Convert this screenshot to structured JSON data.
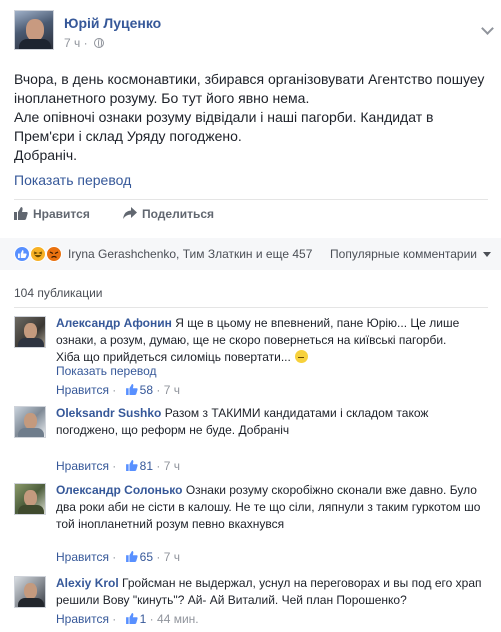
{
  "post": {
    "author": "Юрій Луценко",
    "time": "7 ч",
    "privacy_icon": "globe-icon",
    "lines": [
      "Вчора, в день космонавтики, збирався організовувати Агентство пошуеу",
      "інопланетного розуму. Бо тут його явно нема.",
      "Але опівночі ознаки розуму відвідали і наші пагорби. Кандидат в",
      "Прем'єри і склад Уряду погоджено.",
      "Добраніч."
    ],
    "translate_label": "Показать перевод"
  },
  "actions": {
    "like_label": "Нравится",
    "share_label": "Поделиться"
  },
  "reactions": {
    "icons": [
      "like-icon",
      "haha-icon",
      "angry-icon"
    ],
    "text": "Iryna Gerashchenko, Тим Златкин и еще 457",
    "sort_label": "Популярные комментарии"
  },
  "comments_count_label": "104 публикации",
  "comments": [
    {
      "author": "Александр Афонин",
      "lines": [
        "Я ще в цьому не впевнений, пане Юрію... Це лише",
        "ознаки, а розум, думаю, ще не скоро повернеться на київські пагорби.",
        "Хіба що прийдеться силоміць повертати..."
      ],
      "translate_label": "Показать перевод",
      "like_label": "Нравится",
      "likes": "58",
      "time": "7 ч"
    },
    {
      "author": "Oleksandr Sushko",
      "lines": [
        "Разом з ТАКИМИ кандидатами і складом також",
        "погоджено, що реформ не буде. Добраніч"
      ],
      "like_label": "Нравится",
      "likes": "81",
      "time": "7 ч"
    },
    {
      "author": "Олександр Солонько",
      "lines": [
        "Ознаки розуму скоробіжно сконали вже давно. Було",
        "два роки аби не сісти в калошу. Не те що сіли, ляпнули з таким гуркотом шо",
        "той інопланетний розум певно вкахнувся"
      ],
      "like_label": "Нравится",
      "likes": "65",
      "time": "7 ч"
    },
    {
      "author": "Alexiy Krol",
      "lines": [
        "Гройсман не выдержал, уснул на переговорах и вы под его храп",
        "решили Вову \"кинуть\"? Ай- Ай Виталий. Чей план Порошенко?"
      ],
      "like_label": "Нравится",
      "likes": "1",
      "time": "44 мин."
    }
  ]
}
